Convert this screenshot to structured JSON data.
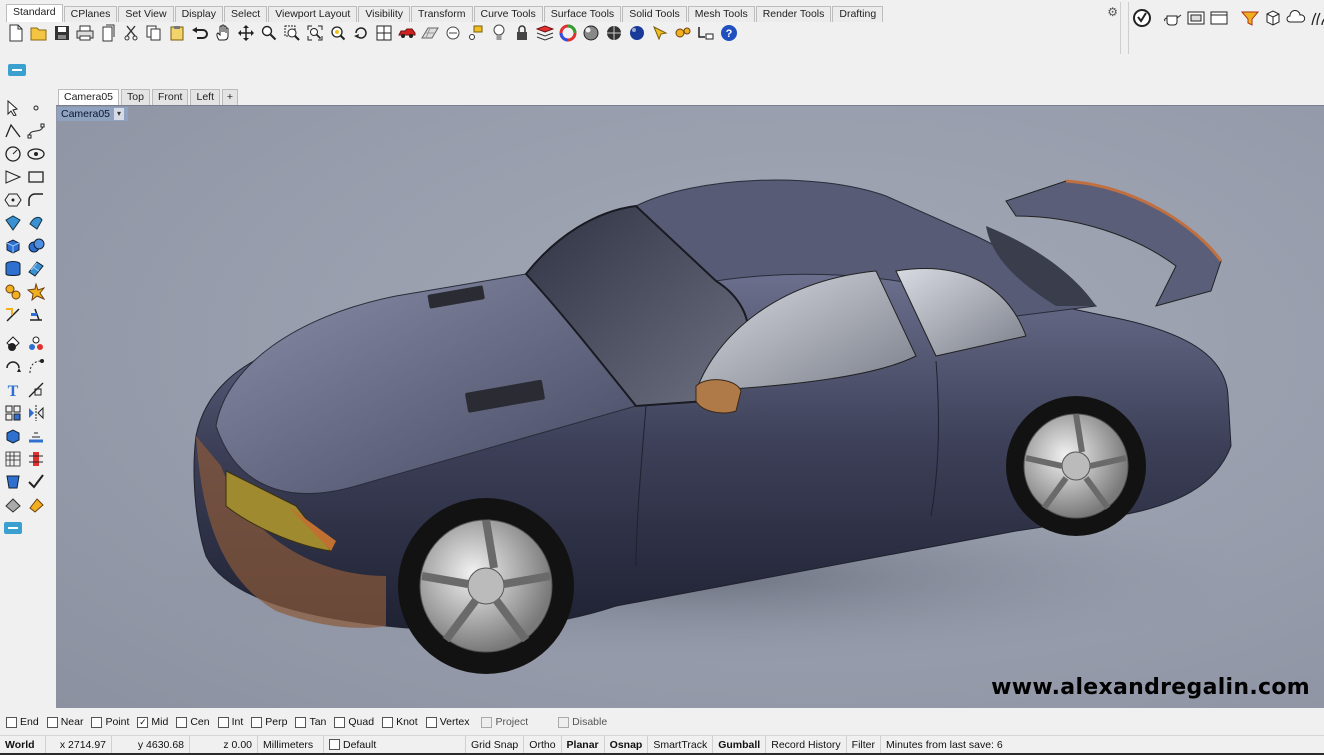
{
  "tabs": [
    "Standard",
    "CPlanes",
    "Set View",
    "Display",
    "Select",
    "Viewport Layout",
    "Visibility",
    "Transform",
    "Curve Tools",
    "Surface Tools",
    "Solid Tools",
    "Mesh Tools",
    "Render Tools",
    "Drafting"
  ],
  "active_tab": "Standard",
  "toolbar_icons": [
    "new-icon",
    "open-icon",
    "save-icon",
    "print-icon",
    "import-icon",
    "cut-icon",
    "copy-icon",
    "paste-icon",
    "undo-icon",
    "pan-icon",
    "move-view-icon",
    "zoom-icon",
    "zoom-window-icon",
    "zoom-extents-icon",
    "zoom-selected-icon",
    "rotate-view-icon",
    "four-viewports-icon",
    "car-icon",
    "grid-icon",
    "circle-dot-icon",
    "points-icon",
    "light-icon",
    "lock-icon",
    "layer-icon",
    "color-wheel-icon",
    "material-ball-icon",
    "render-sphere-icon",
    "render-preview-icon",
    "cursor-icon",
    "gear-icon",
    "options-icon",
    "help-icon"
  ],
  "right_tools": [
    "rhino-logo-icon",
    "teapot-icon",
    "window-icon",
    "viewport-icon",
    "filter-icon",
    "box-icon",
    "cloud-icon",
    "grass-icon"
  ],
  "viewport_tabs": [
    "Camera05",
    "Top",
    "Front",
    "Left",
    "+"
  ],
  "active_viewport_tab": "Camera05",
  "viewport_label": "Camera05",
  "viewport_caret": "▾",
  "watermark": "www.alexandregalin.com",
  "osnaps": [
    {
      "label": "End",
      "checked": false,
      "enabled": true
    },
    {
      "label": "Near",
      "checked": false,
      "enabled": true
    },
    {
      "label": "Point",
      "checked": false,
      "enabled": true
    },
    {
      "label": "Mid",
      "checked": true,
      "enabled": true
    },
    {
      "label": "Cen",
      "checked": false,
      "enabled": true
    },
    {
      "label": "Int",
      "checked": false,
      "enabled": true
    },
    {
      "label": "Perp",
      "checked": false,
      "enabled": true
    },
    {
      "label": "Tan",
      "checked": false,
      "enabled": true
    },
    {
      "label": "Quad",
      "checked": false,
      "enabled": true
    },
    {
      "label": "Knot",
      "checked": false,
      "enabled": true
    },
    {
      "label": "Vertex",
      "checked": false,
      "enabled": true
    },
    {
      "label": "Project",
      "checked": false,
      "enabled": false
    },
    {
      "label": "Disable",
      "checked": false,
      "enabled": false
    }
  ],
  "status": {
    "cplane": "World",
    "x": "x 2714.97",
    "y": "y 4630.68",
    "z": "z 0.00",
    "units": "Millimeters",
    "layer": "Default",
    "grid_snap": "Grid Snap",
    "ortho": "Ortho",
    "planar": "Planar",
    "osnap": "Osnap",
    "smarttrack": "SmartTrack",
    "gumball": "Gumball",
    "record_history": "Record History",
    "filter": "Filter",
    "save_msg": "Minutes from last save: 6"
  },
  "colors": {
    "viewport_bg": "#979dac",
    "car_body": "#3c3f57",
    "label_bg": "#8fa2c0"
  }
}
